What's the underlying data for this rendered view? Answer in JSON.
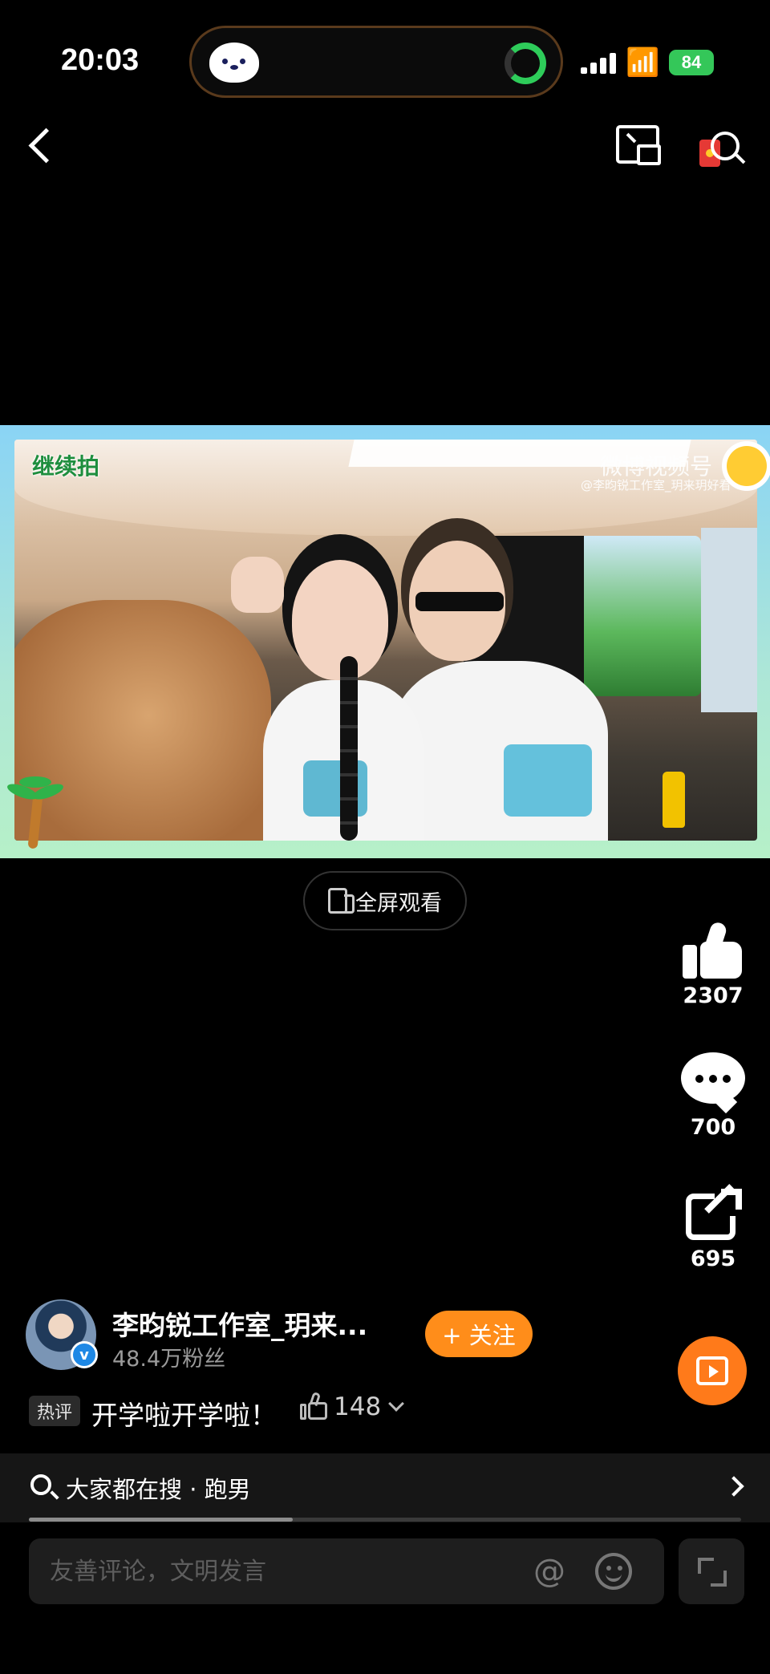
{
  "status_bar": {
    "time": "20:03",
    "battery": "84"
  },
  "video": {
    "watermark_left": "继续拍",
    "watermark_right": "微博视频号",
    "watermark_credit": "@李昀锐工作室_玥来玥好看"
  },
  "fullscreen_button": {
    "label": "全屏观看"
  },
  "actions": {
    "like_count": "2307",
    "comment_count": "700",
    "share_count": "695"
  },
  "author": {
    "name": "李昀锐工作室_玥来...",
    "fans": "48.4万粉丝",
    "follow_label": "+ 关注"
  },
  "hot_comment": {
    "tag": "热评",
    "text": "开学啦开学啦！",
    "likes": "148"
  },
  "search": {
    "text": "大家都在搜 · 跑男"
  },
  "playback": {
    "progress": 0.37
  },
  "comment_box": {
    "placeholder": "友善评论，文明发言"
  },
  "colors": {
    "accent_orange": "#ff8d1a",
    "verified_blue": "#1e88e5",
    "battery_green": "#34c759"
  }
}
